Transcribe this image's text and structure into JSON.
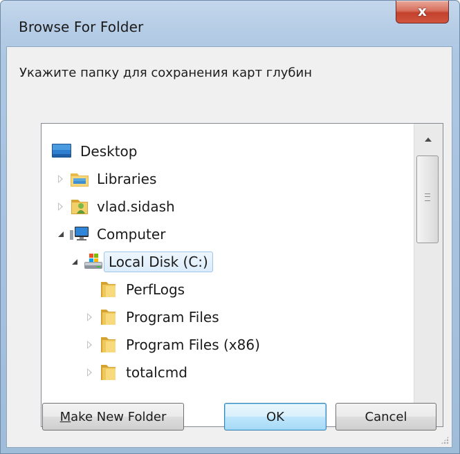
{
  "window": {
    "title": "Browse For Folder",
    "close_label": "x"
  },
  "dialog": {
    "description": "Укажите папку для сохранения карт глубин"
  },
  "tree": {
    "items": [
      {
        "label": "Desktop",
        "icon": "desktop-icon",
        "expander": "none",
        "selected": false
      },
      {
        "label": "Libraries",
        "icon": "libraries-icon",
        "expander": "collapsed",
        "selected": false
      },
      {
        "label": "vlad.sidash",
        "icon": "user-folder-icon",
        "expander": "collapsed",
        "selected": false
      },
      {
        "label": "Computer",
        "icon": "computer-icon",
        "expander": "expanded",
        "selected": false
      },
      {
        "label": "Local Disk (C:)",
        "icon": "drive-icon",
        "expander": "expanded",
        "selected": true
      },
      {
        "label": "PerfLogs",
        "icon": "folder-icon",
        "expander": "none",
        "selected": false
      },
      {
        "label": "Program Files",
        "icon": "folder-icon",
        "expander": "collapsed",
        "selected": false
      },
      {
        "label": "Program Files (x86)",
        "icon": "folder-icon",
        "expander": "collapsed",
        "selected": false
      },
      {
        "label": "totalcmd",
        "icon": "folder-icon",
        "expander": "collapsed",
        "selected": false
      }
    ]
  },
  "buttons": {
    "make_new_folder": "Make New Folder",
    "ok": "OK",
    "cancel": "Cancel"
  },
  "colors": {
    "selection_border": "#9cc3e8",
    "close_button": "#c2412d",
    "default_button_border": "#3c7fb1"
  }
}
